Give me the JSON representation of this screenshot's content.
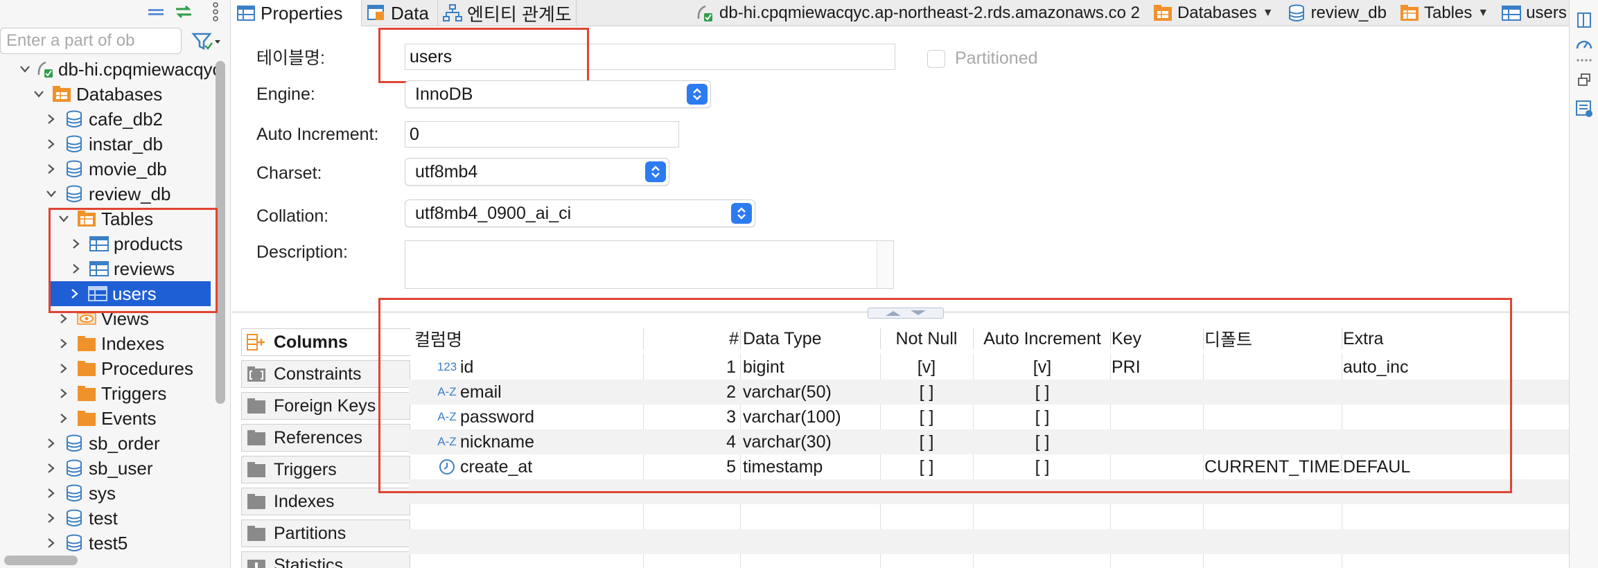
{
  "navigator": {
    "filter_placeholder": "Enter a part of ob",
    "tree": [
      {
        "label": "db-hi.cpqmiewacqyc",
        "icon": "connection-icon",
        "level": 0,
        "expanded": true
      },
      {
        "label": "Databases",
        "icon": "databases-folder-icon",
        "level": 1,
        "expanded": true
      },
      {
        "label": "cafe_db2",
        "icon": "database-icon",
        "level": 2,
        "expanded": false
      },
      {
        "label": "instar_db",
        "icon": "database-icon",
        "level": 2,
        "expanded": false
      },
      {
        "label": "movie_db",
        "icon": "database-icon",
        "level": 2,
        "expanded": false
      },
      {
        "label": "review_db",
        "icon": "database-icon",
        "level": 2,
        "expanded": true
      },
      {
        "label": "Tables",
        "icon": "tables-folder-icon",
        "level": 3,
        "expanded": true
      },
      {
        "label": "products",
        "icon": "table-icon",
        "level": 4,
        "expanded": false
      },
      {
        "label": "reviews",
        "icon": "table-icon",
        "level": 4,
        "expanded": false
      },
      {
        "label": "users",
        "icon": "table-icon",
        "level": 4,
        "expanded": false,
        "selected": true
      },
      {
        "label": "Views",
        "icon": "views-icon",
        "level": 3,
        "expanded": false
      },
      {
        "label": "Indexes",
        "icon": "folder-icon",
        "level": 3,
        "expanded": false
      },
      {
        "label": "Procedures",
        "icon": "folder-icon",
        "level": 3,
        "expanded": false
      },
      {
        "label": "Triggers",
        "icon": "folder-icon",
        "level": 3,
        "expanded": false
      },
      {
        "label": "Events",
        "icon": "folder-icon",
        "level": 3,
        "expanded": false
      },
      {
        "label": "sb_order",
        "icon": "database-icon",
        "level": 2,
        "expanded": false
      },
      {
        "label": "sb_user",
        "icon": "database-icon",
        "level": 2,
        "expanded": false
      },
      {
        "label": "sys",
        "icon": "database-icon",
        "level": 2,
        "expanded": false
      },
      {
        "label": "test",
        "icon": "database-icon",
        "level": 2,
        "expanded": false
      },
      {
        "label": "test5",
        "icon": "database-icon",
        "level": 2,
        "expanded": false
      }
    ]
  },
  "editor": {
    "tabs": [
      {
        "label": "Properties",
        "icon": "properties-icon",
        "active": true
      },
      {
        "label": "Data",
        "icon": "data-grid-icon",
        "active": false
      },
      {
        "label": "엔티티 관계도",
        "icon": "er-diagram-icon",
        "active": false
      }
    ],
    "breadcrumb": [
      {
        "label": "db-hi.cpqmiewacqyc.ap-northeast-2.rds.amazonaws.co 2",
        "icon": "connection-icon",
        "dropdown": false
      },
      {
        "label": "Databases",
        "icon": "databases-folder-icon",
        "dropdown": true
      },
      {
        "label": "review_db",
        "icon": "database-icon",
        "dropdown": false
      },
      {
        "label": "Tables",
        "icon": "tables-folder-icon",
        "dropdown": true
      },
      {
        "label": "users",
        "icon": "table-icon",
        "dropdown": false
      }
    ],
    "properties": {
      "table_name_label": "테이블명:",
      "table_name_value": "users",
      "partitioned_label": "Partitioned",
      "partitioned_checked": false,
      "engine_label": "Engine:",
      "engine_value": "InnoDB",
      "auto_increment_label": "Auto Increment:",
      "auto_increment_value": "0",
      "charset_label": "Charset:",
      "charset_value": "utf8mb4",
      "collation_label": "Collation:",
      "collation_value": "utf8mb4_0900_ai_ci",
      "description_label": "Description:",
      "description_value": ""
    },
    "sub_tabs": [
      {
        "label": "Columns",
        "icon": "columns-icon",
        "active": true
      },
      {
        "label": "Constraints",
        "icon": "constraints-icon",
        "active": false
      },
      {
        "label": "Foreign Keys",
        "icon": "folder-icon",
        "active": false
      },
      {
        "label": "References",
        "icon": "folder-icon",
        "active": false
      },
      {
        "label": "Triggers",
        "icon": "folder-icon",
        "active": false
      },
      {
        "label": "Indexes",
        "icon": "folder-icon",
        "active": false
      },
      {
        "label": "Partitions",
        "icon": "folder-icon",
        "active": false
      },
      {
        "label": "Statistics",
        "icon": "info-icon",
        "active": false
      }
    ],
    "columns_grid": {
      "headers": [
        "컬럼명",
        "#",
        "Data Type",
        "Not Null",
        "Auto Increment",
        "Key",
        "디폴트",
        "Extra"
      ],
      "rows": [
        {
          "type_icon": "numeric-icon",
          "type_icon_text": "123",
          "name": "id",
          "num": "1",
          "data_type": "bigint",
          "not_null": "[v]",
          "auto_increment": "[v]",
          "key": "PRI",
          "default": "",
          "extra": "auto_inc"
        },
        {
          "type_icon": "string-icon",
          "type_icon_text": "A-Z",
          "name": "email",
          "num": "2",
          "data_type": "varchar(50)",
          "not_null": "[ ]",
          "auto_increment": "[ ]",
          "key": "",
          "default": "",
          "extra": ""
        },
        {
          "type_icon": "string-icon",
          "type_icon_text": "A-Z",
          "name": "password",
          "num": "3",
          "data_type": "varchar(100)",
          "not_null": "[ ]",
          "auto_increment": "[ ]",
          "key": "",
          "default": "",
          "extra": ""
        },
        {
          "type_icon": "string-icon",
          "type_icon_text": "A-Z",
          "name": "nickname",
          "num": "4",
          "data_type": "varchar(30)",
          "not_null": "[ ]",
          "auto_increment": "[ ]",
          "key": "",
          "default": "",
          "extra": ""
        },
        {
          "type_icon": "clock-icon",
          "type_icon_text": "",
          "name": "create_at",
          "num": "5",
          "data_type": "timestamp",
          "not_null": "[ ]",
          "auto_increment": "[ ]",
          "key": "",
          "default": "CURRENT_TIMESTAMP",
          "extra": "DEFAUL"
        }
      ]
    }
  },
  "colors": {
    "selection": "#1f5fd6",
    "highlight_box": "#e04433",
    "db_icon": "#3b7fc4",
    "folder_icon": "#f0922b",
    "select_stepper": "#2c7bf0"
  }
}
